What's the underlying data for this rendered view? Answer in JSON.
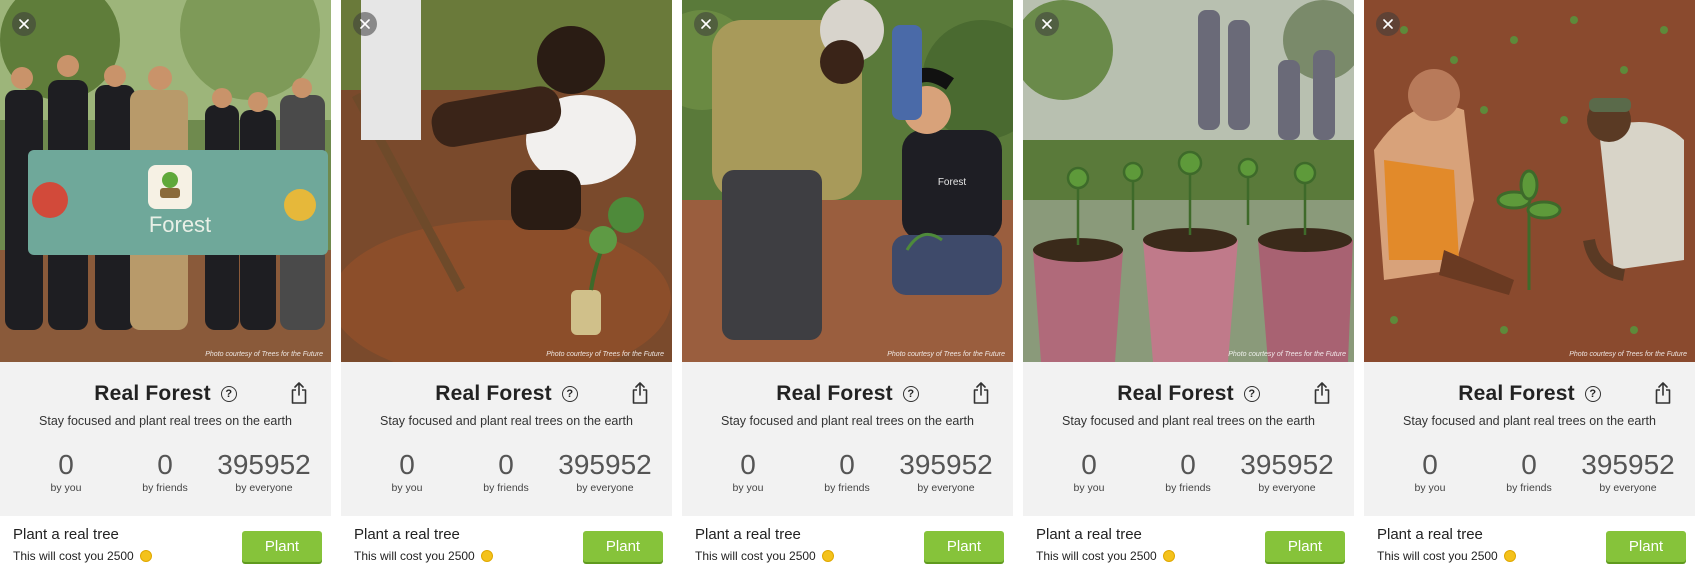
{
  "screens": [
    {
      "close_icon": "close-icon",
      "credit": "Photo courtesy of Trees for the Future",
      "title": "Real Forest",
      "subtitle": "Stay focused and plant real trees on the earth",
      "stats": [
        {
          "value": "0",
          "label": "by you"
        },
        {
          "value": "0",
          "label": "by friends"
        },
        {
          "value": "395952",
          "label": "by everyone"
        }
      ],
      "plant_title": "Plant a real tree",
      "cost_text": "This will cost you 2500",
      "plant_button": "Plant",
      "banner_text": "Forest"
    },
    {
      "close_icon": "close-icon",
      "credit": "Photo courtesy of Trees for the Future",
      "title": "Real Forest",
      "subtitle": "Stay focused and plant real trees on the earth",
      "stats": [
        {
          "value": "0",
          "label": "by you"
        },
        {
          "value": "0",
          "label": "by friends"
        },
        {
          "value": "395952",
          "label": "by everyone"
        }
      ],
      "plant_title": "Plant a real tree",
      "cost_text": "This will cost you 2500",
      "plant_button": "Plant"
    },
    {
      "close_icon": "close-icon",
      "credit": "Photo courtesy of Trees for the Future",
      "title": "Real Forest",
      "subtitle": "Stay focused and plant real trees on the earth",
      "stats": [
        {
          "value": "0",
          "label": "by you"
        },
        {
          "value": "0",
          "label": "by friends"
        },
        {
          "value": "395952",
          "label": "by everyone"
        }
      ],
      "plant_title": "Plant a real tree",
      "cost_text": "This will cost you 2500",
      "plant_button": "Plant",
      "shirt_text": "Forest"
    },
    {
      "close_icon": "close-icon",
      "credit": "Photo courtesy of Trees for the Future",
      "title": "Real Forest",
      "subtitle": "Stay focused and plant real trees on the earth",
      "stats": [
        {
          "value": "0",
          "label": "by you"
        },
        {
          "value": "0",
          "label": "by friends"
        },
        {
          "value": "395952",
          "label": "by everyone"
        }
      ],
      "plant_title": "Plant a real tree",
      "cost_text": "This will cost you 2500",
      "plant_button": "Plant"
    },
    {
      "close_icon": "close-icon",
      "credit": "Photo courtesy of Trees for the Future",
      "title": "Real Forest",
      "subtitle": "Stay focused and plant real trees on the earth",
      "stats": [
        {
          "value": "0",
          "label": "by you"
        },
        {
          "value": "0",
          "label": "by friends"
        },
        {
          "value": "395952",
          "label": "by everyone"
        }
      ],
      "plant_title": "Plant a real tree",
      "cost_text": "This will cost you 2500",
      "plant_button": "Plant"
    }
  ],
  "colors": {
    "accent_green": "#86c33a",
    "coin_gold": "#f4c21b",
    "panel_bg": "#f2f2f2"
  }
}
